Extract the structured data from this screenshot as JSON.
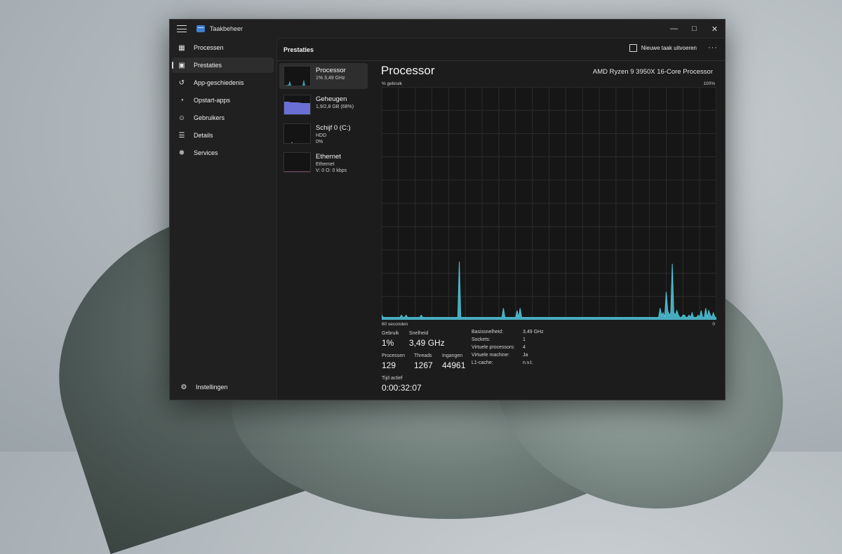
{
  "window": {
    "title": "Taakbeheer"
  },
  "sidebar": {
    "items": [
      {
        "label": "Processen",
        "icon": "grid-icon"
      },
      {
        "label": "Prestaties",
        "icon": "performance-icon",
        "active": true
      },
      {
        "label": "App-geschiedenis",
        "icon": "history-icon"
      },
      {
        "label": "Opstart-apps",
        "icon": "speedometer-icon"
      },
      {
        "label": "Gebruikers",
        "icon": "users-icon"
      },
      {
        "label": "Details",
        "icon": "list-icon"
      },
      {
        "label": "Services",
        "icon": "puzzle-icon"
      }
    ],
    "settings_label": "Instellingen"
  },
  "header": {
    "title": "Prestaties",
    "run_task_label": "Nieuwe taak uitvoeren",
    "more_label": "···"
  },
  "devices": [
    {
      "name": "Processor",
      "sub1": "1% 3,49 GHz",
      "sub2": ""
    },
    {
      "name": "Geheugen",
      "sub1": "1,9/2,8 GB (68%)",
      "sub2": ""
    },
    {
      "name": "Schijf 0 (C:)",
      "sub1": "HDD",
      "sub2": "0%"
    },
    {
      "name": "Ethernet",
      "sub1": "Ethernet",
      "sub2": "V: 0 O: 0 kbps"
    }
  ],
  "panel": {
    "title": "Processor",
    "model": "AMD Ryzen 9 3950X 16-Core Processor",
    "graph_label_left": "% gebruik",
    "graph_label_right": "100%",
    "axis_left": "60 seconden",
    "axis_right": "0"
  },
  "chart_data": {
    "type": "area",
    "ylabel": "% gebruik",
    "xlabel": "60 seconden",
    "ylim": [
      0,
      100
    ],
    "grid": true,
    "series_color": "#4fc3d9",
    "values": [
      2,
      1,
      1,
      1,
      1,
      1,
      1,
      1,
      1,
      1,
      1,
      1,
      1,
      2,
      1,
      1,
      2,
      1,
      1,
      1,
      1,
      1,
      1,
      1,
      1,
      1,
      2,
      1,
      1,
      1,
      1,
      1,
      1,
      1,
      1,
      1,
      1,
      1,
      1,
      1,
      1,
      1,
      1,
      1,
      1,
      1,
      1,
      1,
      1,
      1,
      1,
      25,
      1,
      1,
      1,
      1,
      1,
      1,
      1,
      1,
      1,
      1,
      1,
      1,
      1,
      1,
      1,
      1,
      1,
      1,
      1,
      1,
      1,
      1,
      1,
      1,
      1,
      1,
      1,
      1,
      5,
      1,
      1,
      1,
      1,
      1,
      1,
      1,
      1,
      4,
      1,
      5,
      1,
      1,
      1,
      1,
      1,
      1,
      1,
      1,
      1,
      1,
      1,
      1,
      1,
      1,
      1,
      1,
      1,
      1,
      1,
      1,
      1,
      1,
      1,
      1,
      1,
      1,
      1,
      1,
      1,
      1,
      1,
      1,
      1,
      1,
      1,
      1,
      1,
      1,
      1,
      1,
      1,
      1,
      1,
      1,
      1,
      1,
      1,
      1,
      1,
      1,
      1,
      1,
      1,
      1,
      1,
      1,
      1,
      1,
      1,
      1,
      1,
      1,
      1,
      1,
      1,
      1,
      1,
      1,
      1,
      1,
      1,
      1,
      1,
      1,
      1,
      1,
      1,
      1,
      1,
      1,
      1,
      1,
      1,
      1,
      1,
      1,
      1,
      1,
      1,
      1,
      1,
      5,
      2,
      3,
      1,
      12,
      4,
      2,
      3,
      24,
      3,
      2,
      4,
      2,
      1,
      1,
      2,
      2,
      1,
      1,
      2,
      1,
      3,
      1,
      1,
      1,
      2,
      1,
      4,
      1,
      1,
      5,
      1,
      4,
      2,
      1,
      3,
      1,
      1
    ]
  },
  "stats": {
    "usage_label": "Gebruik",
    "usage_value": "1%",
    "speed_label": "Snelheid",
    "speed_value": "3,49 GHz",
    "processes_label": "Processen",
    "processes_value": "129",
    "threads_label": "Threads",
    "threads_value": "1267",
    "handles_label": "Ingangen",
    "handles_value": "44961",
    "uptime_label": "Tijd actief",
    "uptime_value": "0:00:32:07"
  },
  "specs": [
    {
      "key": "Basissnelheid:",
      "value": "3,49 GHz"
    },
    {
      "key": "Sockets:",
      "value": "1"
    },
    {
      "key": "Virtuele processors:",
      "value": "4"
    },
    {
      "key": "Virtuele machine:",
      "value": "Ja"
    },
    {
      "key": "L1-cache:",
      "value": "n.v.t."
    }
  ]
}
